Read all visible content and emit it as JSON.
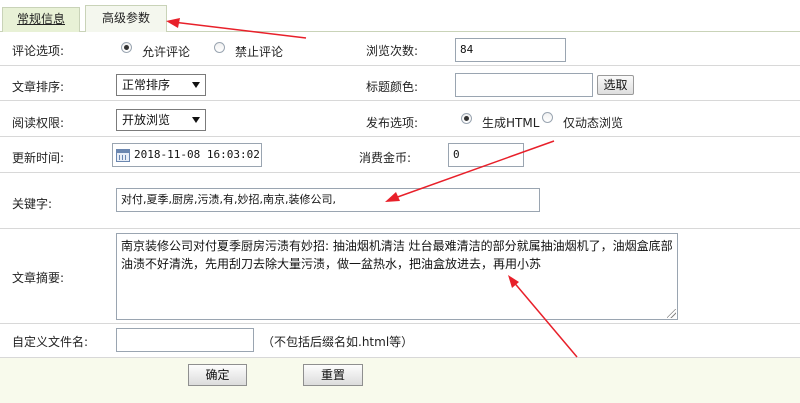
{
  "tabs": [
    {
      "label": "常规信息"
    },
    {
      "label": "高级参数"
    }
  ],
  "comment": {
    "label": "评论选项:",
    "options": [
      {
        "label": "允许评论",
        "checked": true
      },
      {
        "label": "禁止评论",
        "checked": false
      }
    ]
  },
  "views": {
    "label": "浏览次数:",
    "value": "84"
  },
  "sort": {
    "label": "文章排序:",
    "selected": "正常排序"
  },
  "title_color": {
    "label": "标题颜色:",
    "value": "",
    "button": "选取"
  },
  "read_perm": {
    "label": "阅读权限:",
    "selected": "开放浏览"
  },
  "publish": {
    "label": "发布选项:",
    "options": [
      {
        "label": "生成HTML",
        "checked": true
      },
      {
        "label": "仅动态浏览",
        "checked": false
      }
    ]
  },
  "update_time": {
    "label": "更新时间:",
    "value": "2018-11-08 16:03:02"
  },
  "coins": {
    "label": "消费金币:",
    "value": "0"
  },
  "keywords": {
    "label": "关键字:",
    "value": "对付,夏季,厨房,污渍,有,妙招,南京,装修公司,"
  },
  "summary": {
    "label": "文章摘要:",
    "value": "南京装修公司对付夏季厨房污渍有妙招: 抽油烟机清洁 灶台最难清洁的部分就属抽油烟机了，油烟盒底部油渍不好清洗，先用刮刀去除大量污渍，做一盆热水，把油盒放进去，再用小苏"
  },
  "filename": {
    "label": "自定义文件名:",
    "value": "",
    "hint": "（不包括后缀名如.html等）"
  },
  "footer": {
    "confirm": "确定",
    "reset": "重置"
  },
  "colors": {
    "arrow": "#e8202a",
    "tab_active_bg": "#e8f1d6",
    "footer_bg": "#f8faec"
  }
}
